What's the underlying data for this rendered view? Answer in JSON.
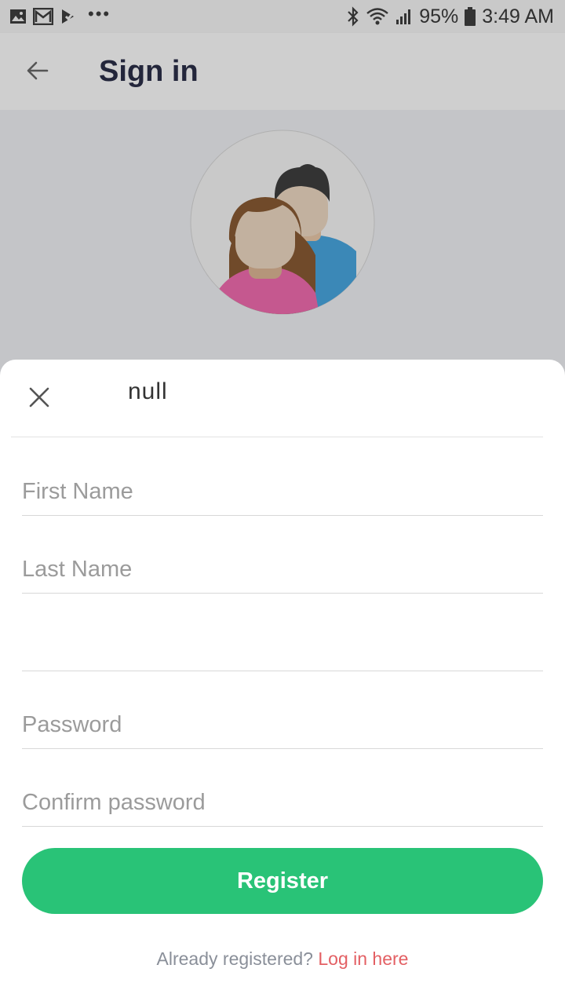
{
  "status_bar": {
    "battery": "95%",
    "time": "3:49 AM",
    "icons": [
      "image-icon",
      "gmail-icon",
      "tasks-icon",
      "more-dots-icon",
      "bluetooth-icon",
      "wifi-icon",
      "signal-icon",
      "battery-icon"
    ]
  },
  "app_bar": {
    "title": "Sign in",
    "back_icon": "arrow-left-icon"
  },
  "hero": {
    "avatar_icon": "two-people-avatar-icon"
  },
  "sheet": {
    "close_icon": "close-icon",
    "title": "null",
    "fields": {
      "first_name": {
        "placeholder": "First Name",
        "value": ""
      },
      "last_name": {
        "placeholder": "Last Name",
        "value": ""
      },
      "email": {
        "placeholder": "",
        "value": ""
      },
      "password": {
        "placeholder": "Password",
        "value": ""
      },
      "confirm_password": {
        "placeholder": "Confirm password",
        "value": ""
      }
    },
    "register_label": "Register",
    "login_prompt": "Already registered?",
    "login_link": "Log in here"
  },
  "colors": {
    "accent_green": "#29c377",
    "link_red": "#e35f63",
    "title_dark": "#23263b"
  }
}
